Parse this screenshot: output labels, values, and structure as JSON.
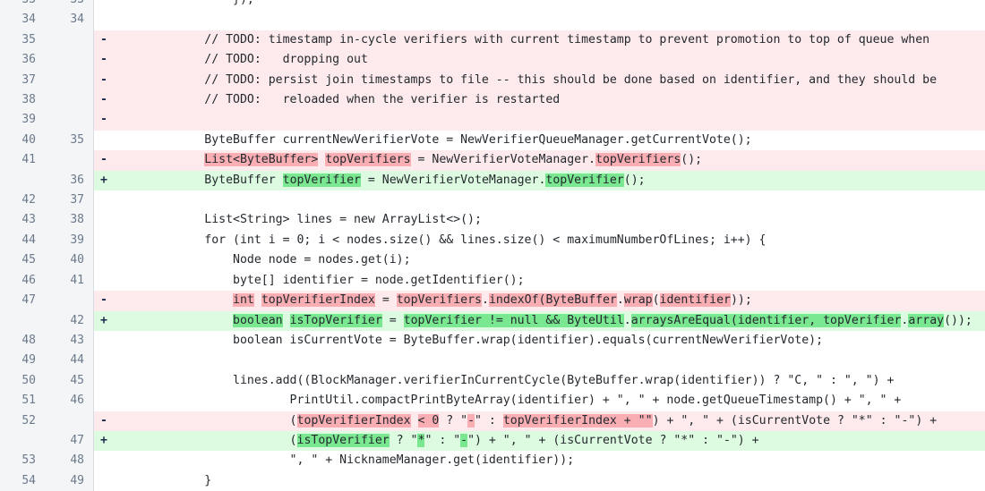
{
  "view": {
    "type": "unified-code-diff",
    "language": "java",
    "colors": {
      "gutter_bg": "#f4f5f7",
      "gutter_text": "#6b7a8c",
      "context_bg": "#ffffff",
      "deleted_bg": "#fdeaec",
      "added_bg": "#ddfbe0",
      "deleted_word_bg": "#f9aeb4",
      "added_word_bg": "#79e890",
      "code_text": "#24292e",
      "marker_text": "#1b2a4a",
      "divider": "#d8dce1"
    },
    "markers": {
      "deleted": "-",
      "added": "+",
      "context": ""
    }
  },
  "rows": [
    {
      "old": "33",
      "new": "33",
      "kind": "ctx",
      "marker": "",
      "clipped_top": true,
      "segments": [
        {
          "t": "                });",
          "h": "none"
        }
      ]
    },
    {
      "old": "34",
      "new": "34",
      "kind": "ctx",
      "marker": "",
      "segments": [
        {
          "t": "",
          "h": "none"
        }
      ]
    },
    {
      "old": "35",
      "new": "",
      "kind": "del",
      "marker": "-",
      "segments": [
        {
          "t": "            // TODO: timestamp in-cycle verifiers with current timestamp to prevent promotion to top of queue when",
          "h": "none"
        }
      ]
    },
    {
      "old": "36",
      "new": "",
      "kind": "del",
      "marker": "-",
      "segments": [
        {
          "t": "            // TODO:   dropping out",
          "h": "none"
        }
      ]
    },
    {
      "old": "37",
      "new": "",
      "kind": "del",
      "marker": "-",
      "segments": [
        {
          "t": "            // TODO: persist join timestamps to file -- this should be done based on identifier, and they should be",
          "h": "none"
        }
      ]
    },
    {
      "old": "38",
      "new": "",
      "kind": "del",
      "marker": "-",
      "segments": [
        {
          "t": "            // TODO:   reloaded when the verifier is restarted",
          "h": "none"
        }
      ]
    },
    {
      "old": "39",
      "new": "",
      "kind": "del",
      "marker": "-",
      "segments": [
        {
          "t": "",
          "h": "none"
        }
      ]
    },
    {
      "old": "40",
      "new": "35",
      "kind": "ctx",
      "marker": "",
      "segments": [
        {
          "t": "            ByteBuffer currentNewVerifierVote = NewVerifierQueueManager.getCurrentVote();",
          "h": "none"
        }
      ]
    },
    {
      "old": "41",
      "new": "",
      "kind": "del",
      "marker": "-",
      "segments": [
        {
          "t": "            ",
          "h": "none"
        },
        {
          "t": "List<ByteBuffer>",
          "h": "del"
        },
        {
          "t": " ",
          "h": "none"
        },
        {
          "t": "topVerifiers",
          "h": "del"
        },
        {
          "t": " = NewVerifierVoteManager.",
          "h": "none"
        },
        {
          "t": "topVerifiers",
          "h": "del"
        },
        {
          "t": "();",
          "h": "none"
        }
      ]
    },
    {
      "old": "",
      "new": "36",
      "kind": "add",
      "marker": "+",
      "segments": [
        {
          "t": "            ByteBuffer ",
          "h": "none"
        },
        {
          "t": "topVerifier",
          "h": "add"
        },
        {
          "t": " = NewVerifierVoteManager.",
          "h": "none"
        },
        {
          "t": "topVerifier",
          "h": "add"
        },
        {
          "t": "();",
          "h": "none"
        }
      ]
    },
    {
      "old": "42",
      "new": "37",
      "kind": "ctx",
      "marker": "",
      "segments": [
        {
          "t": "",
          "h": "none"
        }
      ]
    },
    {
      "old": "43",
      "new": "38",
      "kind": "ctx",
      "marker": "",
      "segments": [
        {
          "t": "            List<String> lines = new ArrayList<>();",
          "h": "none"
        }
      ]
    },
    {
      "old": "44",
      "new": "39",
      "kind": "ctx",
      "marker": "",
      "segments": [
        {
          "t": "            for (int i = 0; i < nodes.size() && lines.size() < maximumNumberOfLines; i++) {",
          "h": "none"
        }
      ]
    },
    {
      "old": "45",
      "new": "40",
      "kind": "ctx",
      "marker": "",
      "segments": [
        {
          "t": "                Node node = nodes.get(i);",
          "h": "none"
        }
      ]
    },
    {
      "old": "46",
      "new": "41",
      "kind": "ctx",
      "marker": "",
      "segments": [
        {
          "t": "                byte[] identifier = node.getIdentifier();",
          "h": "none"
        }
      ]
    },
    {
      "old": "47",
      "new": "",
      "kind": "del",
      "marker": "-",
      "segments": [
        {
          "t": "                ",
          "h": "none"
        },
        {
          "t": "int",
          "h": "del"
        },
        {
          "t": " ",
          "h": "none"
        },
        {
          "t": "topVerifierIndex",
          "h": "del"
        },
        {
          "t": " = ",
          "h": "none"
        },
        {
          "t": "topVerifiers",
          "h": "del"
        },
        {
          "t": ".",
          "h": "none"
        },
        {
          "t": "indexOf(",
          "h": "del"
        },
        {
          "t": "ByteBuffer",
          "h": "del"
        },
        {
          "t": ".",
          "h": "none"
        },
        {
          "t": "wrap",
          "h": "del"
        },
        {
          "t": "(",
          "h": "none"
        },
        {
          "t": "identifier",
          "h": "del"
        },
        {
          "t": "));",
          "h": "none"
        }
      ]
    },
    {
      "old": "",
      "new": "42",
      "kind": "add",
      "marker": "+",
      "segments": [
        {
          "t": "                ",
          "h": "none"
        },
        {
          "t": "boolean",
          "h": "add"
        },
        {
          "t": " ",
          "h": "none"
        },
        {
          "t": "isTopVerifier",
          "h": "add"
        },
        {
          "t": " = ",
          "h": "none"
        },
        {
          "t": "topVerifier != null && ByteUtil",
          "h": "add"
        },
        {
          "t": ".",
          "h": "none"
        },
        {
          "t": "arraysAreEqual(identifier, topVerifier",
          "h": "add"
        },
        {
          "t": ".",
          "h": "none"
        },
        {
          "t": "array",
          "h": "add"
        },
        {
          "t": "());",
          "h": "none"
        }
      ]
    },
    {
      "old": "48",
      "new": "43",
      "kind": "ctx",
      "marker": "",
      "segments": [
        {
          "t": "                boolean isCurrentVote = ByteBuffer.wrap(identifier).equals(currentNewVerifierVote);",
          "h": "none"
        }
      ]
    },
    {
      "old": "49",
      "new": "44",
      "kind": "ctx",
      "marker": "",
      "segments": [
        {
          "t": "",
          "h": "none"
        }
      ]
    },
    {
      "old": "50",
      "new": "45",
      "kind": "ctx",
      "marker": "",
      "segments": [
        {
          "t": "                lines.add((BlockManager.verifierInCurrentCycle(ByteBuffer.wrap(identifier)) ? \"C, \" : \", \") +",
          "h": "none"
        }
      ]
    },
    {
      "old": "51",
      "new": "46",
      "kind": "ctx",
      "marker": "",
      "segments": [
        {
          "t": "                        PrintUtil.compactPrintByteArray(identifier) + \", \" + node.getQueueTimestamp() + \", \" +",
          "h": "none"
        }
      ]
    },
    {
      "old": "52",
      "new": "",
      "kind": "del",
      "marker": "-",
      "segments": [
        {
          "t": "                        (",
          "h": "none"
        },
        {
          "t": "topVerifierIndex",
          "h": "del"
        },
        {
          "t": " ",
          "h": "none"
        },
        {
          "t": "< 0",
          "h": "del"
        },
        {
          "t": " ? \"",
          "h": "none"
        },
        {
          "t": "-",
          "h": "del"
        },
        {
          "t": "\" : ",
          "h": "none"
        },
        {
          "t": "topVerifierIndex + ",
          "h": "del"
        },
        {
          "t": "\"\"",
          "h": "del"
        },
        {
          "t": ") + \", \" + (isCurrentVote ? \"*\" : \"-\") +",
          "h": "none"
        }
      ]
    },
    {
      "old": "",
      "new": "47",
      "kind": "add",
      "marker": "+",
      "segments": [
        {
          "t": "                        (",
          "h": "none"
        },
        {
          "t": "isTopVerifier",
          "h": "add"
        },
        {
          "t": " ? \"",
          "h": "none"
        },
        {
          "t": "*",
          "h": "add"
        },
        {
          "t": "\" : \"",
          "h": "none"
        },
        {
          "t": "-",
          "h": "add"
        },
        {
          "t": "\") + \", \" + (isCurrentVote ? \"*\" : \"-\") +",
          "h": "none"
        }
      ]
    },
    {
      "old": "53",
      "new": "48",
      "kind": "ctx",
      "marker": "",
      "segments": [
        {
          "t": "                        \", \" + NicknameManager.get(identifier));",
          "h": "none"
        }
      ]
    },
    {
      "old": "54",
      "new": "49",
      "kind": "ctx",
      "marker": "",
      "clipped_bottom": true,
      "segments": [
        {
          "t": "            }",
          "h": "none"
        }
      ]
    }
  ]
}
